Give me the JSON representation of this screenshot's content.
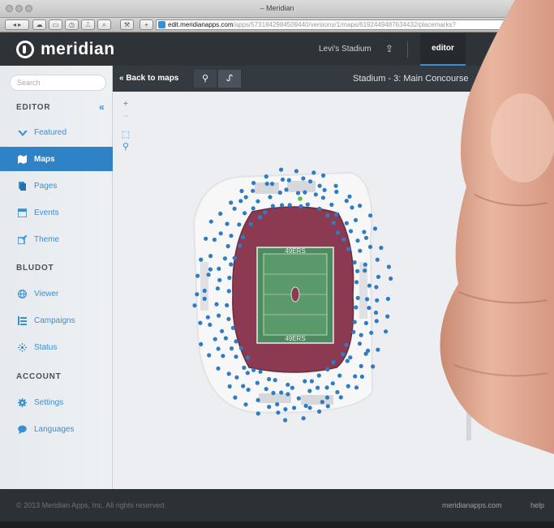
{
  "browser": {
    "window_title": "– Meridian",
    "url_host": "edit.meridianapps.com",
    "url_path": "/apps/5731842984509440/versions/1/maps/6192449487634432/placemarks?"
  },
  "header": {
    "logo_text": "meridian",
    "venue": "Levi's Stadium",
    "editor_label": "editor"
  },
  "sidebar": {
    "search_placeholder": "Search",
    "sections": {
      "editor": "EDITOR",
      "bludot": "BLUDOT",
      "account": "ACCOUNT"
    },
    "collapse_glyph": "«",
    "editor_items": [
      {
        "label": "Featured",
        "icon": "check-mark-icon"
      },
      {
        "label": "Maps",
        "icon": "map-icon",
        "active": true
      },
      {
        "label": "Pages",
        "icon": "pages-icon"
      },
      {
        "label": "Events",
        "icon": "calendar-icon"
      },
      {
        "label": "Theme",
        "icon": "paint-icon"
      }
    ],
    "bludot_items": [
      {
        "label": "Viewer",
        "icon": "globe-icon"
      },
      {
        "label": "Campaigns",
        "icon": "list-icon"
      },
      {
        "label": "Status",
        "icon": "signal-icon"
      }
    ],
    "account_items": [
      {
        "label": "Settings",
        "icon": "gear-icon"
      },
      {
        "label": "Languages",
        "icon": "speech-bubble-icon"
      }
    ]
  },
  "map": {
    "back_label": "« Back to maps",
    "title": "Stadium - 3: Main Concourse",
    "field_text_top": "49ERS",
    "field_text_bottom": "49ERS",
    "colors": {
      "accent": "#3a8fd0",
      "seats": "#8b3a52",
      "field": "#4c8c5e",
      "placemark": "#2f7cc4",
      "placemark_highlight": "#55c04b"
    }
  },
  "footer": {
    "copyright": "© 2013 Meridian Apps, Inc. All rights reserved.",
    "site": "meridianapps.com",
    "help": "help"
  }
}
